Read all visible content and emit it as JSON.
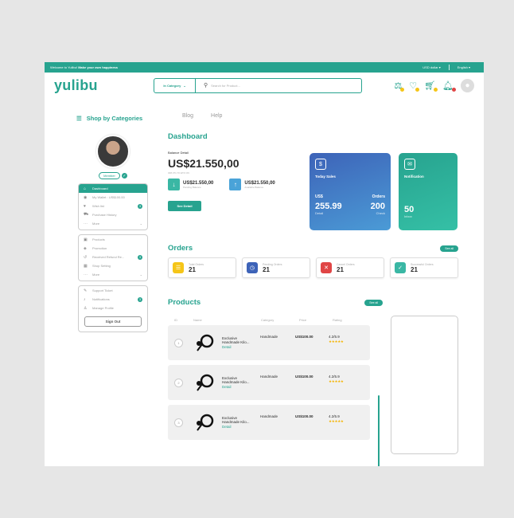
{
  "topbar": {
    "welcome": "Welcome to Yulibu!",
    "tagline": "Make your own happiness",
    "currency": "USD dollar",
    "language": "English"
  },
  "header": {
    "logo": "yulibu",
    "category": "In Category",
    "search_placeholder": "Search for Product..."
  },
  "nav": {
    "categories": "Shop by Categories",
    "links": [
      "Blog",
      "Help"
    ]
  },
  "profile": {
    "member": "Member"
  },
  "sidebar": {
    "group1": [
      {
        "label": "Dashboard",
        "icon": "home-icon",
        "active": true
      },
      {
        "label": "My Wallet : US$100.00",
        "icon": "wallet-icon"
      },
      {
        "label": "Wish list",
        "icon": "heart-icon",
        "badge": "3"
      },
      {
        "label": "Purchase History",
        "icon": "cart-icon"
      },
      {
        "label": "More",
        "icon": "more-icon"
      }
    ],
    "group2": [
      {
        "label": "Products",
        "icon": "box-icon"
      },
      {
        "label": "Promotion",
        "icon": "tag-icon"
      },
      {
        "label": "Received Refund Re...",
        "icon": "refund-icon",
        "badge": "3"
      },
      {
        "label": "Shop Setting",
        "icon": "shop-icon"
      },
      {
        "label": "More",
        "icon": "more-icon"
      }
    ],
    "group3": [
      {
        "label": "Support Ticket",
        "icon": "ticket-icon"
      },
      {
        "label": "Notifications",
        "icon": "bell-icon",
        "badge": "3"
      },
      {
        "label": "Manage Profile",
        "icon": "user-icon"
      }
    ],
    "signout": "Sign Out"
  },
  "dashboard": {
    "title": "Dashboard",
    "balance_label": "Balance Detail",
    "balance": "US$21.550,00",
    "balance_sub": "308.371.70 ETZ ON",
    "mini": [
      {
        "value": "US$21.550,00",
        "label": "Pending Balance"
      },
      {
        "value": "US$21.550,00",
        "label": "Available Balance"
      }
    ],
    "see_detail": "See Detail"
  },
  "sales_card": {
    "title": "Today Sales",
    "col1": "US$",
    "col2": "Orders",
    "val1": "255.99",
    "val2": "200",
    "sub1": "Detail",
    "sub2": "Check"
  },
  "notif_card": {
    "title": "Notification",
    "value": "50",
    "sub": "Inbox"
  },
  "orders": {
    "title": "Orders",
    "see_all": "See all",
    "cards": [
      {
        "label": "Total Orders",
        "value": "21",
        "icon": "list-icon",
        "color": "#f5c518"
      },
      {
        "label": "Pending Orders",
        "value": "21",
        "icon": "clock-icon",
        "color": "#3d63b8"
      },
      {
        "label": "Cancel Orders",
        "value": "21",
        "icon": "cancel-icon",
        "color": "#e04545"
      },
      {
        "label": "Successful Orders",
        "value": "21",
        "icon": "check-icon",
        "color": "#3ab7a4"
      }
    ]
  },
  "products": {
    "title": "Products",
    "see_all": "See all",
    "headers": [
      "ID",
      "Name",
      "Category",
      "Price",
      "Rating"
    ],
    "rows": [
      {
        "id": "1",
        "name": "Exclusive Handmade Kilo...",
        "detail": "Detail",
        "category": "Handmade",
        "price": "US$100.00",
        "rating": "4.2/5.9"
      },
      {
        "id": "2",
        "name": "Exclusive Handmade Kilo...",
        "detail": "Detail",
        "category": "Handmade",
        "price": "US$100.00",
        "rating": "4.2/5.9"
      },
      {
        "id": "3",
        "name": "Exclusive Handmade Kilo...",
        "detail": "Detail",
        "category": "Handmade",
        "price": "US$100.00",
        "rating": "4.2/5.9"
      }
    ]
  }
}
